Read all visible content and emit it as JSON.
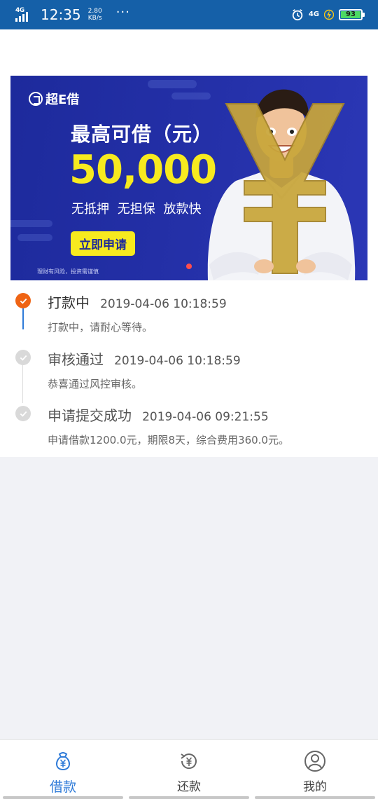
{
  "status_bar": {
    "network": "4G",
    "network_sup": "HD",
    "time": "12:35",
    "speed_value": "2.80",
    "speed_unit": "KB/s",
    "menu": "···",
    "network_right": "4G",
    "battery": "93"
  },
  "banner": {
    "brand": "超E借",
    "title": "最高可借（元）",
    "amount": "50,000",
    "tags": "无抵押 无担保 放款快",
    "cta": "立即申请",
    "note": "理财有风险，投资需谨慎"
  },
  "timeline": [
    {
      "status": "打款中",
      "time": "2019-04-06 10:18:59",
      "desc": "打款中，请耐心等待。",
      "state": "active"
    },
    {
      "status": "审核通过",
      "time": "2019-04-06 10:18:59",
      "desc": "恭喜通过风控审核。",
      "state": "done"
    },
    {
      "status": "申请提交成功",
      "time": "2019-04-06 09:21:55",
      "desc": "申请借款1200.0元，期限8天，综合费用360.0元。",
      "state": "done"
    }
  ],
  "bottom_nav": {
    "items": [
      {
        "label": "借款",
        "icon": "money-bag-icon",
        "active": true
      },
      {
        "label": "还款",
        "icon": "repay-icon",
        "active": false
      },
      {
        "label": "我的",
        "icon": "profile-icon",
        "active": false
      }
    ]
  },
  "colors": {
    "status_bar": "#1560a8",
    "accent_blue": "#2f7bd8",
    "active_orange": "#ef6414",
    "banner_blue": "#232fa6",
    "banner_yellow": "#f7ea1f"
  }
}
